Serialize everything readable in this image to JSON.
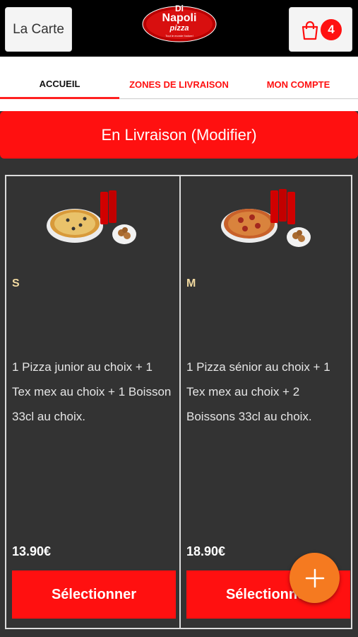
{
  "header": {
    "menu_label": "La Carte",
    "cart_count": "4",
    "logo": {
      "line1": "Di",
      "line2": "Napoli",
      "line3": "pizza",
      "tagline": "Tout le monde t'adore!"
    }
  },
  "tabs": [
    {
      "label": "ACCUEIL"
    },
    {
      "label": "ZONES DE LIVRAISON"
    },
    {
      "label": "MON COMPTE"
    }
  ],
  "delivery_banner": "En Livraison (Modifier)",
  "menus": [
    {
      "size": "S",
      "description": "1 Pizza junior au choix  + 1 Tex mex au choix  + 1 Boisson 33cl au choix.",
      "price": "13.90€",
      "button": "Sélectionner"
    },
    {
      "size": "M",
      "description": "1 Pizza sénior au choix  + 1 Tex mex au choix  + 2 Boissons 33cl au choix.",
      "price": "18.90€",
      "button": "Sélectionner"
    }
  ],
  "colors": {
    "accent": "#ff1010",
    "fab": "#f57a20",
    "panel": "#333333"
  },
  "icons": {
    "cart": "shopping-bag-icon",
    "fab": "plus-icon"
  }
}
